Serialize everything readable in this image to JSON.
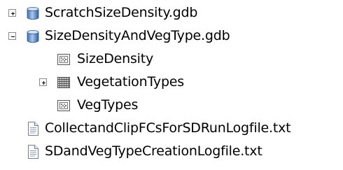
{
  "tree": {
    "items": [
      {
        "label": "ScratchSizeDensity.gdb",
        "icon": "geodatabase-icon",
        "expander": "collapsed"
      },
      {
        "label": "SizeDensityAndVegType.gdb",
        "icon": "geodatabase-icon",
        "expander": "expanded"
      },
      {
        "label": "SizeDensity",
        "icon": "raster-dataset-icon",
        "expander": "none"
      },
      {
        "label": "VegetationTypes",
        "icon": "raster-catalog-icon",
        "expander": "collapsed"
      },
      {
        "label": "VegTypes",
        "icon": "raster-dataset-icon",
        "expander": "none"
      },
      {
        "label": "CollectandClipFCsForSDRunLogfile.txt",
        "icon": "text-file-icon",
        "expander": "none"
      },
      {
        "label": "SDandVegTypeCreationLogfile.txt",
        "icon": "text-file-icon",
        "expander": "none"
      }
    ]
  },
  "colors": {
    "db_blue": "#4a7fc1",
    "db_light": "#cfe0f5",
    "raster_border": "#6b6b6b",
    "file_border": "#7a8aa0"
  }
}
